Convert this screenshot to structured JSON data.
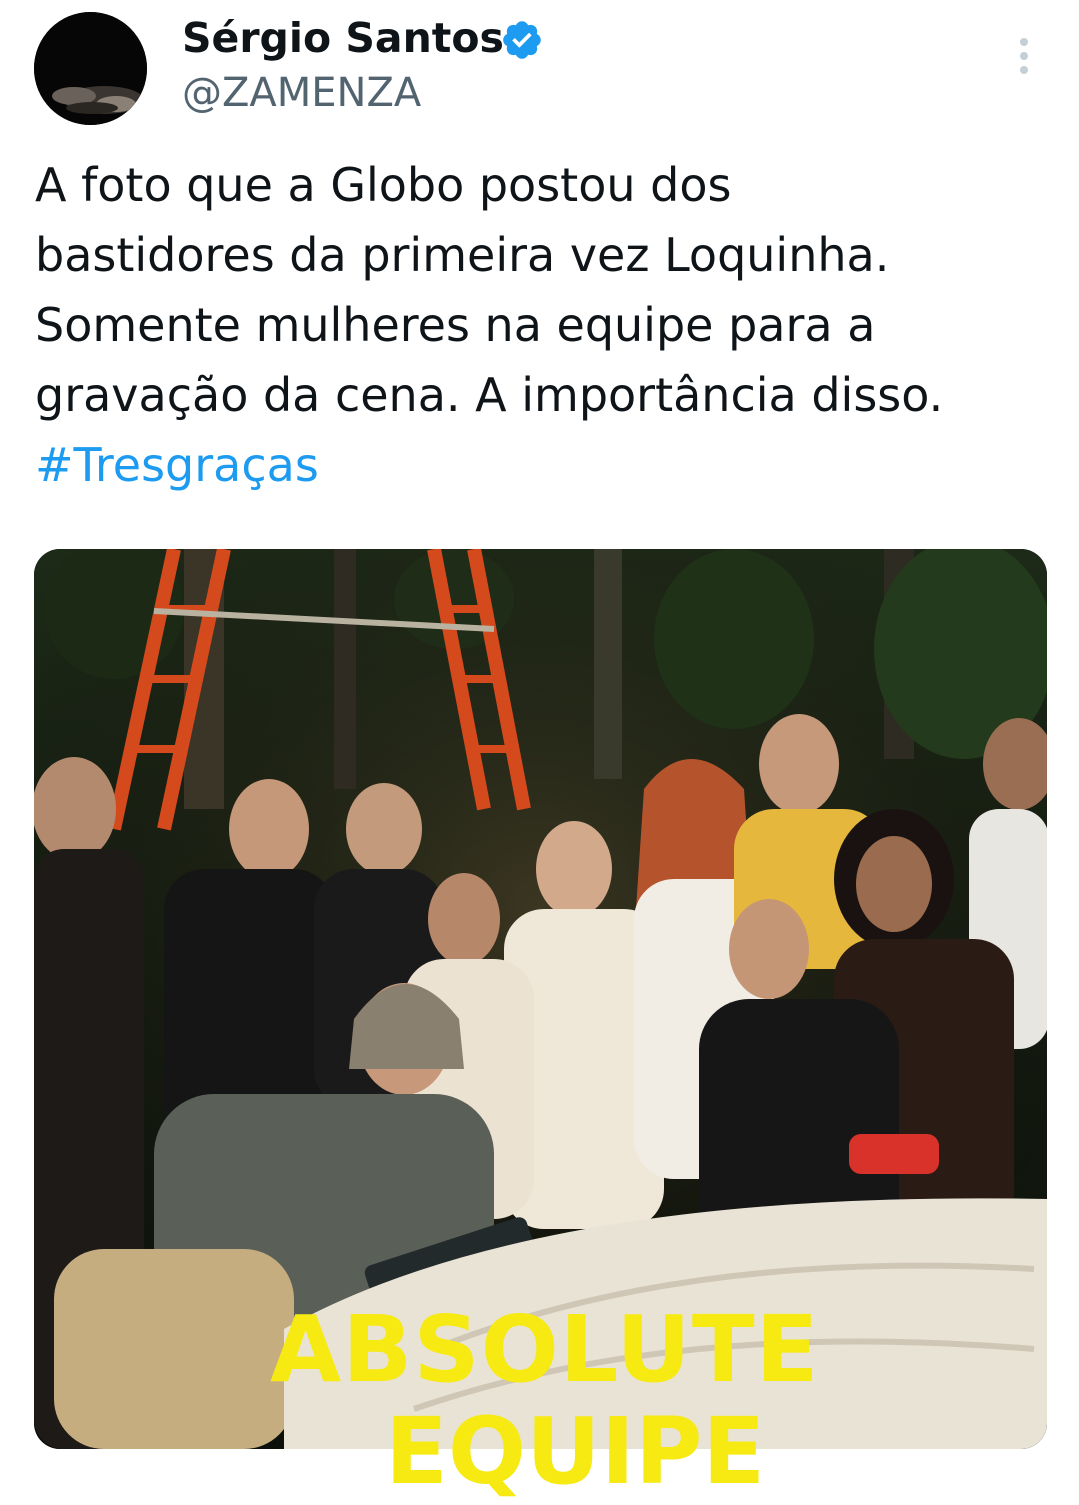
{
  "author": {
    "display_name": "Sérgio Santos",
    "handle": "@ZAMENZA",
    "verified": true,
    "avatar_icon": "avatar-image"
  },
  "menu": {
    "icon": "more-vertical-icon"
  },
  "tweet": {
    "text": "A foto que a Globo postou dos\nbastidores da primeira vez Loquinha.\nSomente mulheres na equipe para a\ngravação da cena. A importância disso.\n",
    "hashtag": "#Tresgraças"
  },
  "media": {
    "overlay_line1": "ABSOLUTE",
    "overlay_line2": "EQUIPE"
  },
  "colors": {
    "link": "#1d9bf0",
    "verified": "#1d9bf0",
    "secondary_text": "#536471",
    "overlay_yellow": "#f6ea12"
  }
}
